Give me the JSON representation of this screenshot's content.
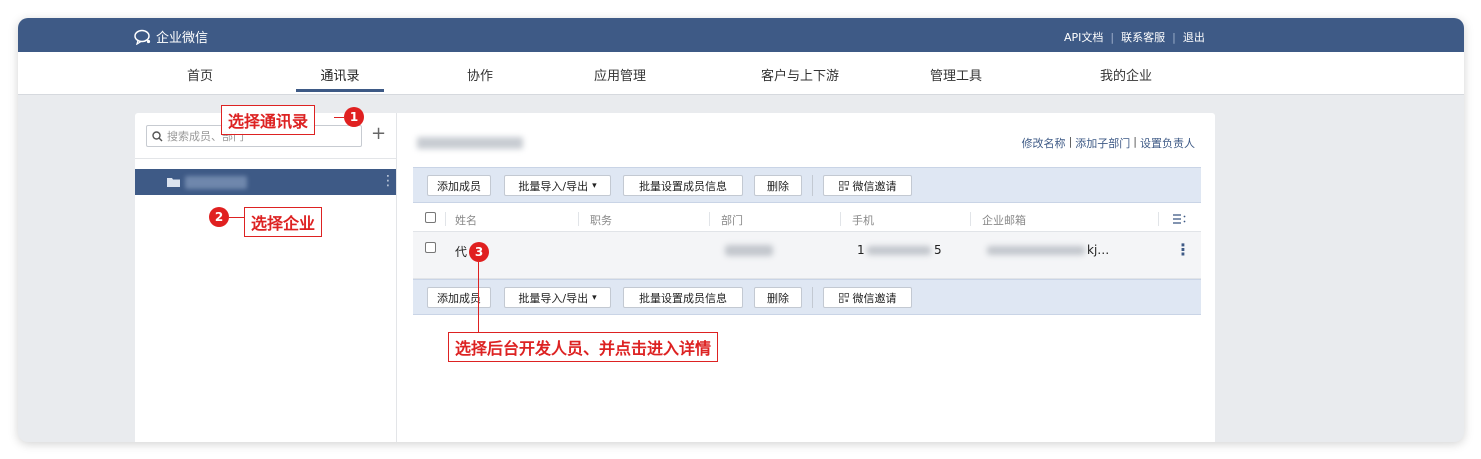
{
  "app": {
    "name": "企业微信"
  },
  "top_links": [
    "API文档",
    "联系客服",
    "退出"
  ],
  "nav": {
    "items": [
      "首页",
      "通讯录",
      "协作",
      "应用管理",
      "客户与上下游",
      "管理工具",
      "我的企业"
    ],
    "active": "通讯录"
  },
  "sidebar": {
    "search_placeholder": "搜索成员、部门",
    "plus_label": "+",
    "dept_more": "⋮"
  },
  "content": {
    "right_links": [
      "修改名称",
      "添加子部门",
      "设置负责人"
    ],
    "toolbar": {
      "add_member": "添加成员",
      "batch_io": "批量导入/导出",
      "batch_io_caret": "▾",
      "batch_set": "批量设置成员信息",
      "delete": "删除",
      "wechat_invite": "微信邀请"
    },
    "table": {
      "headers": [
        "姓名",
        "职务",
        "部门",
        "手机",
        "企业邮箱"
      ],
      "rows": [
        {
          "name": "代 维",
          "phone_start": "1",
          "phone_end": "5",
          "email_tail": "kj…"
        }
      ],
      "row_menu": "⋮"
    }
  },
  "annotations": {
    "step1": {
      "number": "1",
      "text": "选择通讯录"
    },
    "step2": {
      "number": "2",
      "text": "选择企业"
    },
    "step3": {
      "number": "3",
      "text": "选择后台开发人员、并点击进入详情"
    }
  },
  "colors": {
    "header_bg": "#3e5a86",
    "toolbar_bg": "#dfe7f3",
    "annotation": "#dd2222"
  }
}
